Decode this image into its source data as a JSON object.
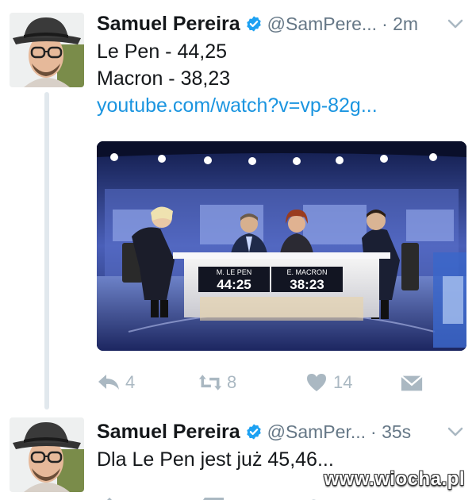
{
  "tweets": [
    {
      "author": {
        "name": "Samuel Pereira",
        "handle": "@SamPere...",
        "verified_icon": "verified-badge-icon"
      },
      "time": "· 2m",
      "text_lines": [
        "Le Pen - 44,25",
        "Macron - 38,23"
      ],
      "link": "youtube.com/watch?v=vp-82g...",
      "media": {
        "lower_third": {
          "left_name": "M. LE PEN",
          "left_score": "44:25",
          "right_name": "E. MACRON",
          "right_score": "38:23"
        }
      },
      "actions": {
        "reply_count": "4",
        "retweet_count": "8",
        "like_count": "14"
      }
    },
    {
      "author": {
        "name": "Samuel Pereira",
        "handle": "@SamPer...",
        "verified_icon": "verified-badge-icon"
      },
      "time": "· 35s",
      "text_lines": [
        "Dla Le Pen jest już 45,46..."
      ]
    }
  ],
  "watermark": "www.wiocha.pl",
  "colors": {
    "text": "#14171a",
    "secondary": "#657786",
    "link": "#1b95e0",
    "verified": "#1da1f2",
    "action": "#aab8c2"
  }
}
